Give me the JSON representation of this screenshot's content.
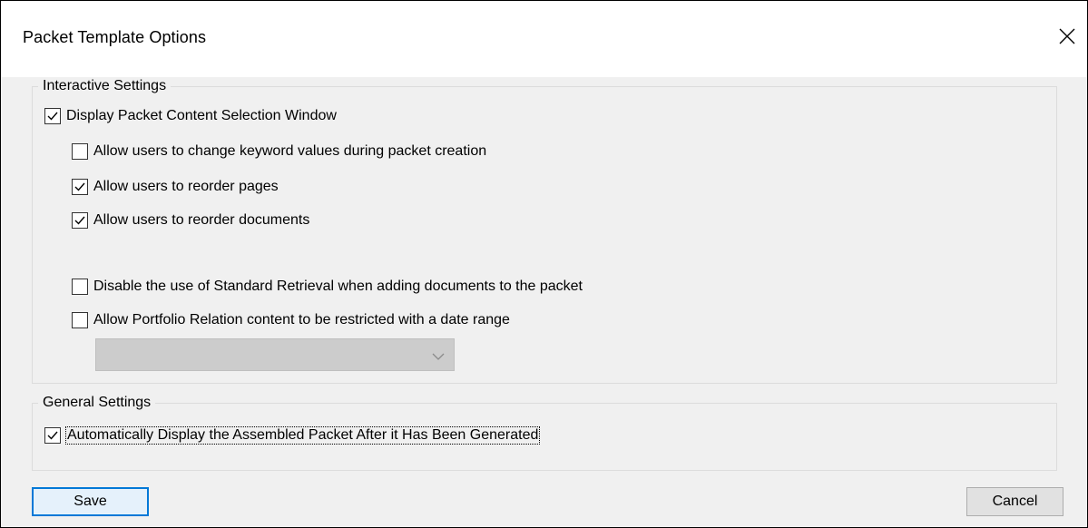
{
  "window": {
    "title": "Packet Template Options",
    "close_icon": "close-icon"
  },
  "interactive_settings": {
    "label": "Interactive Settings",
    "display_content_selection": {
      "label": "Display Packet Content Selection Window",
      "checked": true
    },
    "options": [
      {
        "label": "Allow users to change keyword values during packet creation",
        "checked": false
      },
      {
        "label": "Allow users to reorder pages",
        "checked": true
      },
      {
        "label": "Allow users to reorder documents",
        "checked": true
      },
      {
        "label": "Disable the use of Standard Retrieval when adding documents to the packet",
        "checked": false
      },
      {
        "label": "Allow Portfolio Relation content to be restricted with a date range",
        "checked": false
      }
    ],
    "date_range_select": {
      "value": "",
      "disabled": true
    }
  },
  "general_settings": {
    "label": "General Settings",
    "auto_display": {
      "label": "Automatically Display the Assembled Packet After it Has Been Generated",
      "checked": true
    }
  },
  "buttons": {
    "save_label": "Save",
    "cancel_label": "Cancel"
  },
  "colors": {
    "accent": "#0078d7",
    "dialog_bg": "#f0f0f0",
    "disabled_combo": "#cccccc"
  }
}
